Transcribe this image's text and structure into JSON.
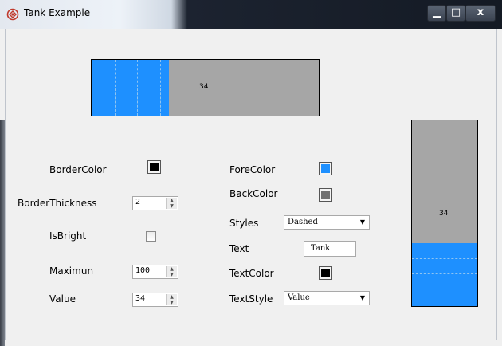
{
  "window": {
    "title": "Tank Example",
    "minimize_glyph": "▁",
    "maximize_glyph": "□",
    "close_glyph": "x"
  },
  "tank_horizontal": {
    "value_text": "34",
    "value": 34,
    "maximum": 100,
    "fill_color": "#1e90ff",
    "back_color": "#a6a6a6"
  },
  "tank_vertical": {
    "value_text": "34",
    "value": 34,
    "maximum": 100,
    "fill_color": "#1e90ff",
    "back_color": "#a6a6a6"
  },
  "form": {
    "border_color": {
      "label": "BorderColor",
      "color": "#000000"
    },
    "border_thickness": {
      "label": "BorderThickness",
      "value": "2"
    },
    "is_bright": {
      "label": "IsBright",
      "checked": false
    },
    "maximum": {
      "label": "Maximun",
      "value": "100"
    },
    "value": {
      "label": "Value",
      "value": "34"
    },
    "fore_color": {
      "label": "ForeColor",
      "color": "#1e90ff"
    },
    "back_color": {
      "label": "BackColor",
      "color": "#707070"
    },
    "styles": {
      "label": "Styles",
      "selected": "Dashed"
    },
    "text": {
      "label": "Text",
      "value": "Tank"
    },
    "text_color": {
      "label": "TextColor",
      "color": "#000000"
    },
    "text_style": {
      "label": "TextStyle",
      "selected": "Value"
    }
  }
}
